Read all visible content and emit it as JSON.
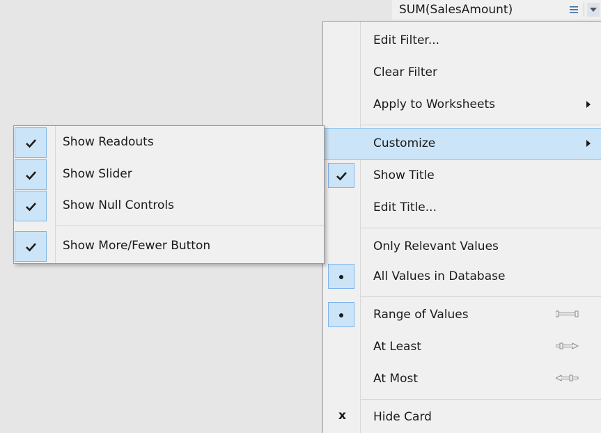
{
  "card": {
    "title": "SUM(SalesAmount)"
  },
  "menu": {
    "edit_filter": "Edit Filter...",
    "clear_filter": "Clear Filter",
    "apply_to_worksheets": "Apply to Worksheets",
    "customize": "Customize",
    "show_title": "Show Title",
    "edit_title": "Edit Title...",
    "only_relevant_values": "Only Relevant Values",
    "all_values_in_database": "All Values in Database",
    "range_of_values": "Range of Values",
    "at_least": "At Least",
    "at_most": "At Most",
    "hide_card": "Hide Card",
    "hide_card_mark": "x"
  },
  "submenu": {
    "show_readouts": "Show Readouts",
    "show_slider": "Show Slider",
    "show_null_controls": "Show Null Controls",
    "show_more_fewer_button": "Show More/Fewer Button"
  },
  "state": {
    "show_title_checked": true,
    "selected_values_scope": "All Values in Database",
    "selected_range_mode": "Range of Values",
    "customize_highlighted": true,
    "show_readouts_checked": true,
    "show_slider_checked": true,
    "show_null_controls_checked": true,
    "show_more_fewer_checked": true
  },
  "colors": {
    "highlight": "#cce4f7",
    "highlight_border": "#7eb4ea",
    "menu_bg": "#f0f0f0",
    "background": "#e6e6e6"
  },
  "icons": {
    "header_list": "list-icon",
    "header_dropdown": "dropdown-arrow-icon",
    "check": "checkmark-icon",
    "radio": "radio-dot-icon",
    "submenu_arrow": "chevron-right-icon",
    "range": "range-slider-icon",
    "at_least": "at-least-slider-icon",
    "at_most": "at-most-slider-icon"
  }
}
